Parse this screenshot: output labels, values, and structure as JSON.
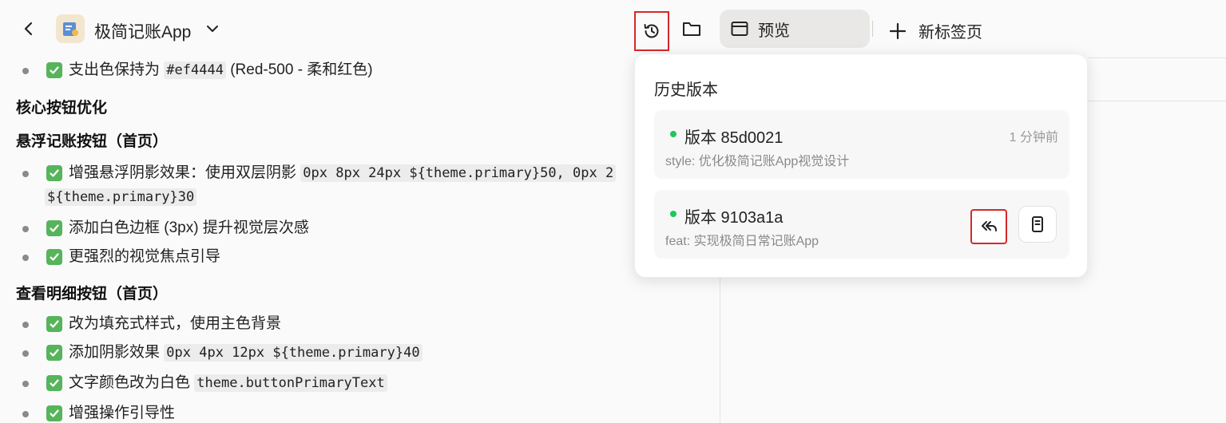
{
  "header": {
    "app_title": "极简记账App",
    "tabs": {
      "preview_label": "预览",
      "new_tab_label": "新标签页"
    }
  },
  "content": {
    "items": [
      {
        "type": "bullet",
        "parts": [
          "支出色保持为 ",
          "#ef4444",
          " (Red-500 - 柔和红色)"
        ]
      },
      {
        "type": "heading",
        "text": "核心按钮优化"
      },
      {
        "type": "heading",
        "text": "悬浮记账按钮（首页）"
      },
      {
        "type": "bullet",
        "parts": [
          "增强悬浮阴影效果：使用双层阴影 ",
          "0px 8px 24px ${theme.primary}50, 0px 2"
        ],
        "continuation": "${theme.primary}30"
      },
      {
        "type": "bullet",
        "parts": [
          "添加白色边框 (3px) 提升视觉层次感"
        ]
      },
      {
        "type": "bullet",
        "parts": [
          "更强烈的视觉焦点引导"
        ]
      },
      {
        "type": "heading",
        "text": "查看明细按钮（首页）"
      },
      {
        "type": "bullet",
        "parts": [
          "改为填充式样式，使用主色背景"
        ]
      },
      {
        "type": "bullet",
        "parts": [
          "添加阴影效果 ",
          "0px 4px 12px ${theme.primary}40"
        ]
      },
      {
        "type": "bullet",
        "parts": [
          "文字颜色改为白色 ",
          "theme.buttonPrimaryText"
        ]
      },
      {
        "type": "bullet",
        "parts": [
          "增强操作引导性"
        ]
      }
    ]
  },
  "history_popup": {
    "title": "历史版本",
    "versions": [
      {
        "name": "版本 85d0021",
        "message": "style: 优化极简记账App视觉设计",
        "time": "1 分钟前"
      },
      {
        "name": "版本 9103a1a",
        "message": "feat: 实现极简日常记账App",
        "time": ""
      }
    ]
  },
  "colors": {
    "accent_green": "#22c55e",
    "check_green": "#56b45b",
    "highlight_red": "#d62828"
  }
}
